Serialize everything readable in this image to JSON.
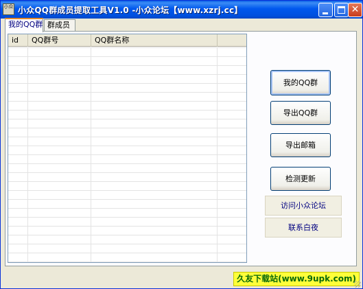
{
  "window": {
    "title": "小众QQ群成员提取工具V1.0 -小众论坛【www.xzrj.cc】",
    "icon_text": "小众",
    "controls": {
      "minimize": "minimize-icon",
      "maximize": "maximize-icon",
      "close": "close-icon"
    },
    "titlebar_color": "#0054e3"
  },
  "tabs": [
    {
      "label": "我的QQ群",
      "active": true
    },
    {
      "label": "群成员",
      "active": false
    }
  ],
  "table": {
    "columns": [
      "id",
      "QQ群号",
      "QQ群名称",
      ""
    ],
    "rows": []
  },
  "buttons": {
    "my_groups": "我的QQ群",
    "export_groups": "导出QQ群",
    "export_email": "导出邮箱",
    "check_update": "检测更新",
    "visit_forum": "访问小众论坛",
    "contact": "联系白夜"
  },
  "statusbar": {
    "watermark": "久友下载站(www.9upk.com)"
  }
}
